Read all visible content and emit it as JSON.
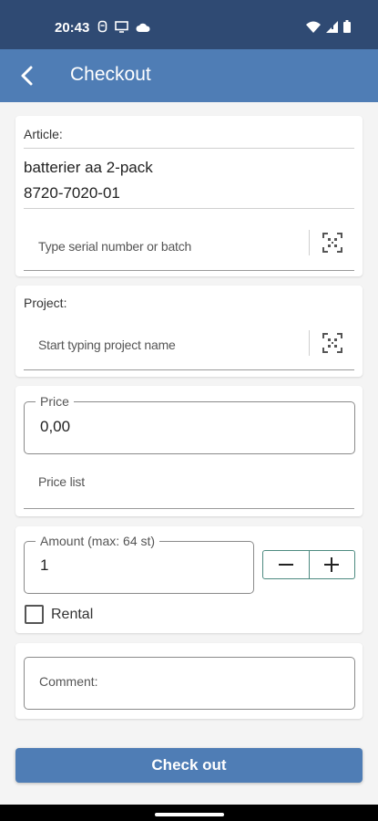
{
  "status_bar": {
    "time": "20:43",
    "icons": [
      "notification-icon",
      "screen-icon",
      "cloud-icon",
      "wifi-icon",
      "signal-icon",
      "battery-icon"
    ]
  },
  "app_bar": {
    "title": "Checkout",
    "back_icon": "back-arrow-icon"
  },
  "article": {
    "label": "Article:",
    "name": "batterier aa 2-pack",
    "code": "8720-7020-01",
    "serial_placeholder": "Type serial number or batch",
    "scan_icon": "qr-scan-icon"
  },
  "project": {
    "label": "Project:",
    "placeholder": "Start typing project name",
    "scan_icon": "qr-scan-icon"
  },
  "price": {
    "label": "Price",
    "value": "0,00",
    "price_list_placeholder": "Price list"
  },
  "amount": {
    "label": "Amount (max: 64 st)",
    "value": "1",
    "decrement": "−",
    "increment": "+",
    "rental_label": "Rental",
    "rental_checked": false
  },
  "comment": {
    "placeholder": "Comment:"
  },
  "checkout_button": {
    "label": "Check out"
  },
  "colors": {
    "status_bar": "#2f4a73",
    "app_bar": "#4f7db5",
    "primary_button": "#4f7db5",
    "stepper_border": "#4d8a80"
  }
}
